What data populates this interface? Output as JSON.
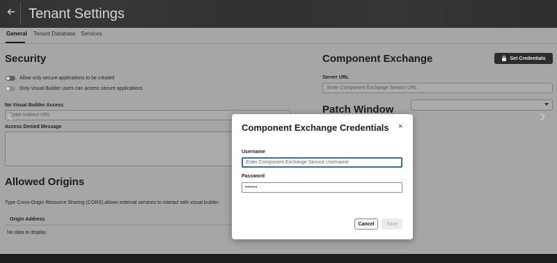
{
  "header": {
    "title": "Tenant Settings",
    "back_icon": "arrow-left-icon"
  },
  "tabs": [
    {
      "label": "General",
      "active": true
    },
    {
      "label": "Tenant Database",
      "active": false
    },
    {
      "label": "Services",
      "active": false
    }
  ],
  "security": {
    "heading": "Security",
    "toggle1_label": "Allow only secure applications to be created",
    "toggle2_label": "Only Visual Builder users can access secure applications",
    "no_access_label": "No Visual Builder Access",
    "redirect_placeholder": "Enter redirect URL",
    "access_denied_label": "Access Denied Message"
  },
  "allowed_origins": {
    "heading": "Allowed Origins",
    "description": "Type Cross-Origin Resource Sharing (CORS) allows external services to interact with visual builder.",
    "column_header": "Origin Address",
    "empty_text": "No data to display."
  },
  "component_exchange": {
    "heading": "Component Exchange",
    "set_credentials_label": "Set Credentials",
    "server_url_label": "Server URL",
    "server_url_placeholder": "Enter Component Exchange Service URL"
  },
  "patch_window": {
    "heading": "Patch Window"
  },
  "dialog": {
    "title": "Component Exchange Credentials",
    "close_glyph": "×",
    "username_label": "Username",
    "username_placeholder": "Enter Component Exchange Service Username",
    "password_label": "Password",
    "password_value": "••••••",
    "cancel_label": "Cancel",
    "save_label": "Save"
  },
  "colors": {
    "header_bg": "#2f2f2f",
    "overlay": "#a6a6a6",
    "focus": "#3b6f87"
  }
}
